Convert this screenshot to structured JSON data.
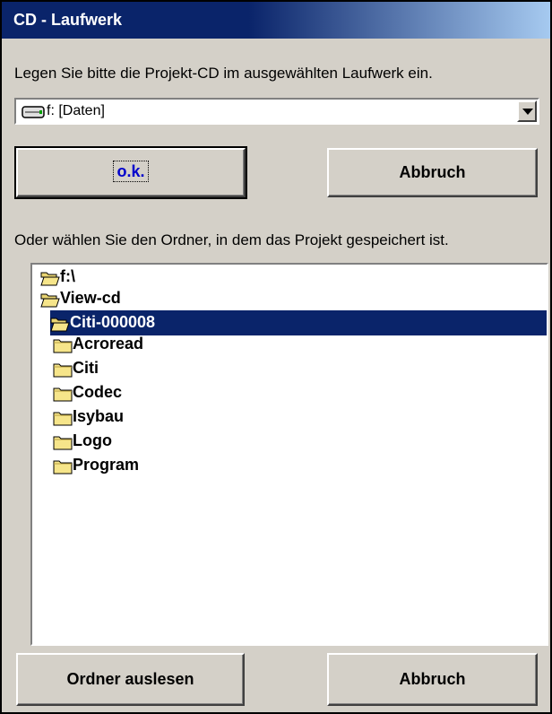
{
  "window": {
    "title": "CD - Laufwerk"
  },
  "instruction": "Legen Sie bitte die Projekt-CD im ausgewählten Laufwerk ein.",
  "drive_select": {
    "value": "f: [Daten]",
    "icon": "drive-icon"
  },
  "buttons": {
    "ok": "o.k.",
    "cancel": "Abbruch",
    "read_folder": "Ordner auslesen"
  },
  "folder_hint": "Oder wählen Sie den Ordner, in dem das Projekt gespeichert ist.",
  "tree": {
    "nodes": [
      {
        "label": "f:\\",
        "icon": "open-folder-icon",
        "state": "open"
      },
      {
        "label": "View-cd",
        "icon": "open-folder-icon",
        "state": "open"
      },
      {
        "label": "Citi-000008",
        "icon": "open-folder-icon",
        "state": "selected"
      },
      {
        "label": "Acroread",
        "icon": "folder-icon",
        "state": "closed"
      },
      {
        "label": "Citi",
        "icon": "folder-icon",
        "state": "closed"
      },
      {
        "label": "Codec",
        "icon": "folder-icon",
        "state": "closed"
      },
      {
        "label": "Isybau",
        "icon": "folder-icon",
        "state": "closed"
      },
      {
        "label": "Logo",
        "icon": "folder-icon",
        "state": "closed"
      },
      {
        "label": "Program",
        "icon": "folder-icon",
        "state": "closed"
      }
    ]
  },
  "colors": {
    "title_bar": "#0a246a",
    "selection": "#0a246a",
    "ok_text": "#0000cc",
    "folder": "#f6e58a",
    "face": "#d4d0c8"
  }
}
